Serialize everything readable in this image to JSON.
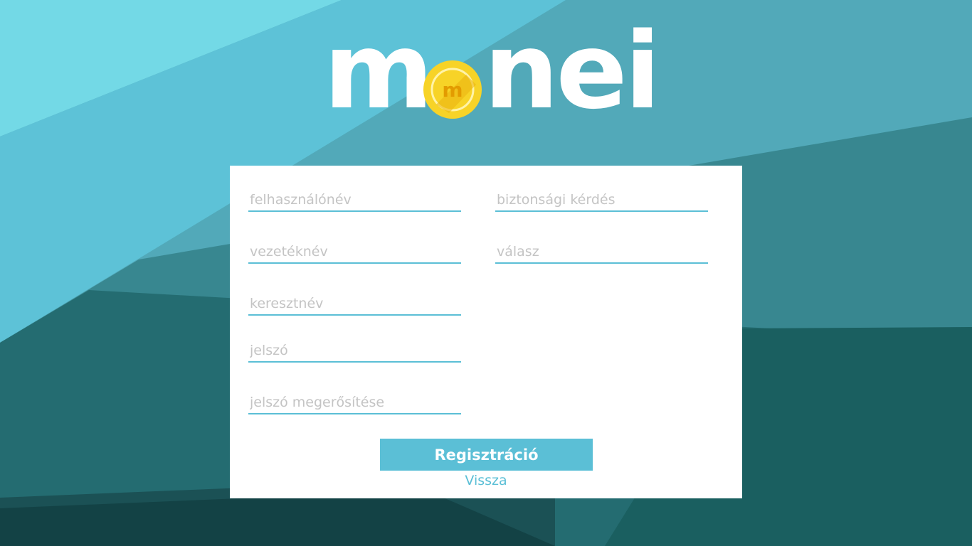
{
  "logo": {
    "text_left": "m",
    "text_right": "nei",
    "coin_letter": "m"
  },
  "form": {
    "left_fields": [
      {
        "name": "felhasznalonev",
        "placeholder": "felhasználónév",
        "value": ""
      },
      {
        "name": "vezeteknev",
        "placeholder": "vezetéknév",
        "value": ""
      },
      {
        "name": "keresztnev",
        "placeholder": "keresztnév",
        "value": ""
      },
      {
        "name": "jelszo",
        "placeholder": "jelszó",
        "value": ""
      },
      {
        "name": "jelszo-megerositese",
        "placeholder": "jelszó megerősítése",
        "value": ""
      }
    ],
    "right_fields": [
      {
        "name": "biztonsagi-kerdes",
        "placeholder": "biztonsági kérdés",
        "value": ""
      },
      {
        "name": "valasz",
        "placeholder": "válasz",
        "value": ""
      }
    ],
    "register_label": "Regisztráció",
    "back_label": "Vissza"
  },
  "colors": {
    "accent": "#5bbfd6",
    "coin_gold": "#f5c518",
    "bg_light": "#73d9e6",
    "bg_dark": "#134245"
  },
  "icons": {
    "coin": "gold-coin-icon"
  }
}
